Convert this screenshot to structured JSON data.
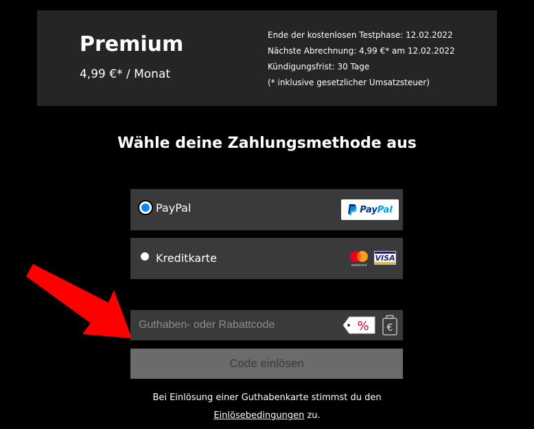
{
  "plan": {
    "name": "Premium",
    "price": "4,99 €* / Monat",
    "details": [
      "Ende der kostenlosen Testphase: 12.02.2022",
      "Nächste Abrechnung: 4,99 €* am 12.02.2022",
      "Kündigungsfrist: 30 Tage",
      "(* inklusive gesetzlicher Umsatzsteuer)"
    ]
  },
  "payment": {
    "title": "Wähle deine Zahlungsmethode aus",
    "options": [
      {
        "label": "PayPal",
        "selected": true,
        "logo_text_a": "Pay",
        "logo_text_b": "Pal"
      },
      {
        "label": "Kreditkarte",
        "selected": false,
        "visa_text": "VISA",
        "mc_text": "mastercard"
      }
    ]
  },
  "code": {
    "placeholder": "Guthaben- oder Rabattcode",
    "redeem_label": "Code einlösen",
    "tag_symbol": "%",
    "coin_symbol": "€"
  },
  "note": {
    "line1": "Bei Einlösung einer Guthabenkarte stimmst du den",
    "link": "Einlösebedingungen",
    "suffix": " zu."
  },
  "colors": {
    "background": "#000000",
    "panel": "#252528",
    "option_bg": "#3a3a3d",
    "radio_selected": "#0a84ff",
    "button_disabled": "#6b6b6d",
    "arrow": "#ff0000"
  }
}
